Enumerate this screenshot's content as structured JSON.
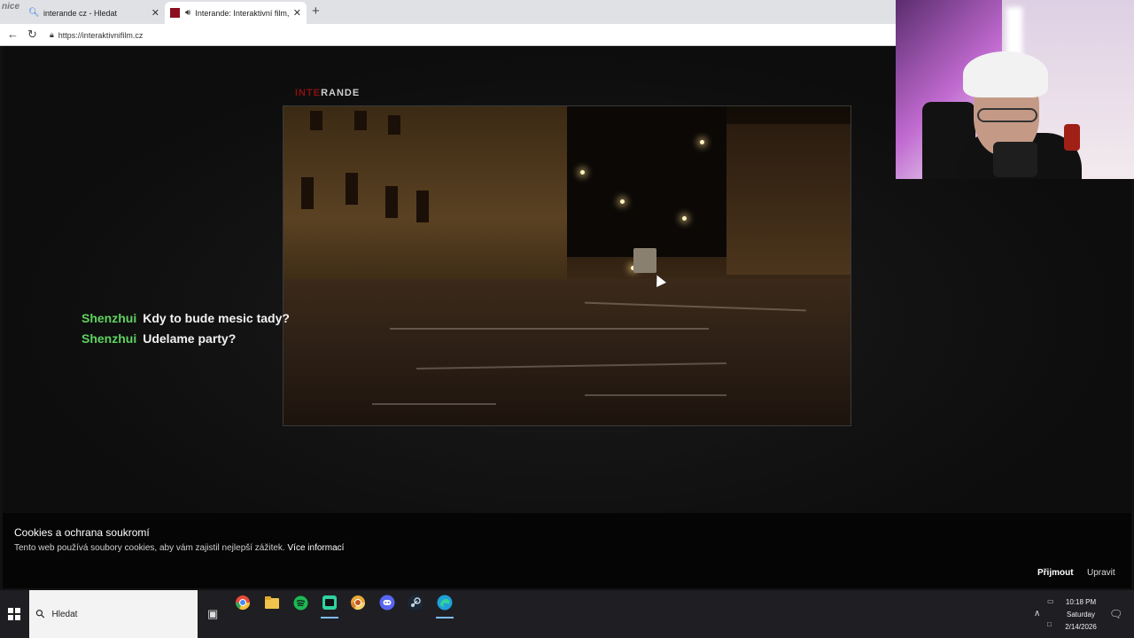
{
  "browser": {
    "corner_logo": "nice",
    "tabs": [
      {
        "title": "interande cz - Hledat",
        "close": "✕"
      },
      {
        "title": "Interande: Interaktivní film, co",
        "close": "✕"
      }
    ],
    "new_tab": "+",
    "url": "https://interaktivnifilm.cz"
  },
  "page": {
    "brand_red": "INTE",
    "brand_rest": "RANDE",
    "chat": [
      {
        "user": "Shenzhui",
        "message": "Kdy to bude mesic tady?"
      },
      {
        "user": "Shenzhui",
        "message": "Udelame party?"
      }
    ],
    "cookie": {
      "title": "Cookies a ochrana soukromí",
      "text": "Tento web používá soubory cookies, aby vám zajistil nejlepší zážitek.",
      "link": "Více informací",
      "accept": "Přijmout",
      "edit": "Upravit"
    }
  },
  "taskbar": {
    "search_placeholder": "Hledat",
    "time": "10:18 PM",
    "day": "Saturday",
    "date": "2/14/2026",
    "apps": [
      "chrome-icon",
      "file-explorer-icon",
      "spotify-icon",
      "gaming-app-icon",
      "chrome-icon",
      "discord-icon",
      "steam-icon",
      "edge-icon"
    ],
    "colors": {
      "spotify": "#1db954",
      "edge": "#1fa0d8",
      "chrome": "#e8a83a",
      "folder": "#f1c34d"
    }
  }
}
